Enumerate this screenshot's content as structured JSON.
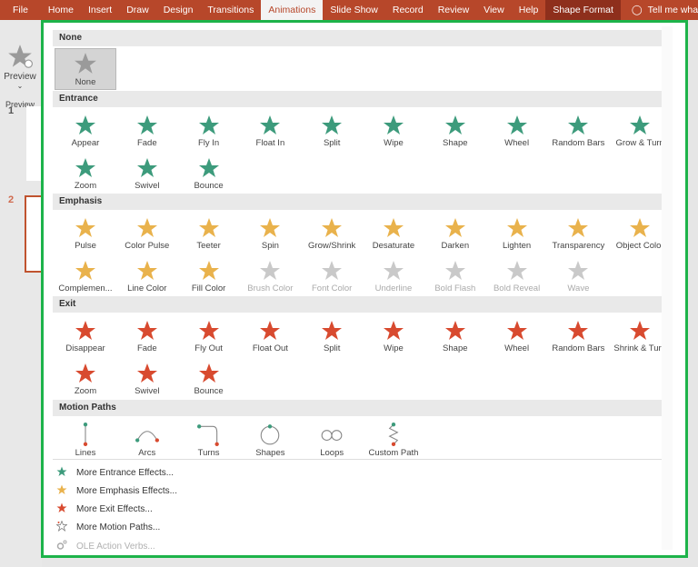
{
  "ribbon": {
    "tabs": [
      {
        "label": "File"
      },
      {
        "label": "Home"
      },
      {
        "label": "Insert"
      },
      {
        "label": "Draw"
      },
      {
        "label": "Design"
      },
      {
        "label": "Transitions"
      },
      {
        "label": "Animations",
        "active": true
      },
      {
        "label": "Slide Show"
      },
      {
        "label": "Record"
      },
      {
        "label": "Review"
      },
      {
        "label": "View"
      },
      {
        "label": "Help"
      },
      {
        "label": "Shape Format",
        "contextual": true
      }
    ],
    "tell_me": "Tell me what"
  },
  "preview": {
    "label": "Preview",
    "group": "Preview"
  },
  "slides": [
    {
      "number": "1"
    },
    {
      "number": "2",
      "selected": true
    }
  ],
  "colors": {
    "entrance": "#3d9b7c",
    "emphasis": "#e9b24c",
    "exit": "#d84a2f",
    "disabled": "#c9c9c9",
    "none": "#9a9a9a",
    "accent": "#b7472a",
    "highlight_border": "#1db34a"
  },
  "sections": [
    {
      "title": "None",
      "kind": "none",
      "items": [
        {
          "label": "None",
          "icon": "star-icon",
          "selected": true
        }
      ]
    },
    {
      "title": "Entrance",
      "kind": "entrance",
      "items": [
        {
          "label": "Appear"
        },
        {
          "label": "Fade"
        },
        {
          "label": "Fly In"
        },
        {
          "label": "Float In"
        },
        {
          "label": "Split"
        },
        {
          "label": "Wipe"
        },
        {
          "label": "Shape"
        },
        {
          "label": "Wheel"
        },
        {
          "label": "Random Bars"
        },
        {
          "label": "Grow & Turn"
        },
        {
          "label": "Zoom"
        },
        {
          "label": "Swivel"
        },
        {
          "label": "Bounce"
        }
      ]
    },
    {
      "title": "Emphasis",
      "kind": "emphasis",
      "items": [
        {
          "label": "Pulse"
        },
        {
          "label": "Color Pulse"
        },
        {
          "label": "Teeter"
        },
        {
          "label": "Spin"
        },
        {
          "label": "Grow/Shrink"
        },
        {
          "label": "Desaturate"
        },
        {
          "label": "Darken"
        },
        {
          "label": "Lighten"
        },
        {
          "label": "Transparency"
        },
        {
          "label": "Object Color"
        },
        {
          "label": "Complemen..."
        },
        {
          "label": "Line Color"
        },
        {
          "label": "Fill Color"
        },
        {
          "label": "Brush Color",
          "disabled": true
        },
        {
          "label": "Font Color",
          "disabled": true
        },
        {
          "label": "Underline",
          "disabled": true
        },
        {
          "label": "Bold Flash",
          "disabled": true
        },
        {
          "label": "Bold Reveal",
          "disabled": true
        },
        {
          "label": "Wave",
          "disabled": true
        }
      ]
    },
    {
      "title": "Exit",
      "kind": "exit",
      "items": [
        {
          "label": "Disappear"
        },
        {
          "label": "Fade"
        },
        {
          "label": "Fly Out"
        },
        {
          "label": "Float Out"
        },
        {
          "label": "Split"
        },
        {
          "label": "Wipe"
        },
        {
          "label": "Shape"
        },
        {
          "label": "Wheel"
        },
        {
          "label": "Random Bars"
        },
        {
          "label": "Shrink & Turn"
        },
        {
          "label": "Zoom"
        },
        {
          "label": "Swivel"
        },
        {
          "label": "Bounce"
        }
      ]
    },
    {
      "title": "Motion Paths",
      "kind": "motion",
      "items": [
        {
          "label": "Lines",
          "icon": "line-path-icon"
        },
        {
          "label": "Arcs",
          "icon": "arc-path-icon"
        },
        {
          "label": "Turns",
          "icon": "turn-path-icon"
        },
        {
          "label": "Shapes",
          "icon": "circle-path-icon"
        },
        {
          "label": "Loops",
          "icon": "loop-path-icon"
        },
        {
          "label": "Custom Path",
          "icon": "custom-path-icon"
        }
      ]
    }
  ],
  "more": [
    {
      "label": "More Entrance Effects...",
      "kind": "entrance"
    },
    {
      "label": "More Emphasis Effects...",
      "kind": "emphasis"
    },
    {
      "label": "More Exit Effects...",
      "kind": "exit"
    },
    {
      "label": "More Motion Paths...",
      "kind": "motion"
    },
    {
      "label": "OLE Action Verbs...",
      "kind": "ole",
      "disabled": true
    }
  ]
}
